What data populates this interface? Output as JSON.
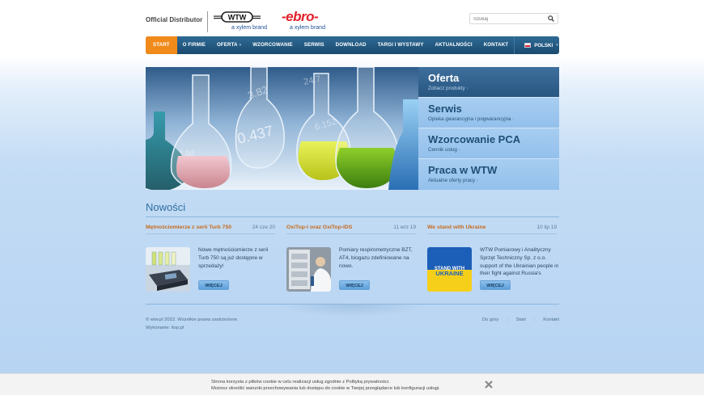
{
  "header": {
    "distributor": "Official Distributor",
    "wtw_logo": "WTW",
    "wtw_sub": "a xylem brand",
    "ebro_logo": "-ebro-",
    "ebro_sub": "a xylem brand",
    "search_placeholder": "Szukaj"
  },
  "nav": {
    "items": [
      {
        "label": "START",
        "active": true,
        "caret": false
      },
      {
        "label": "O FIRMIE",
        "caret": false
      },
      {
        "label": "OFERTA",
        "caret": true
      },
      {
        "label": "WZORCOWANIE",
        "caret": false
      },
      {
        "label": "SERWIS",
        "caret": false
      },
      {
        "label": "DOWNLOAD",
        "caret": false
      },
      {
        "label": "TARGI I WYSTAWY",
        "caret": false
      },
      {
        "label": "AKTUALNOŚCI",
        "caret": false
      },
      {
        "label": "KONTAKT",
        "caret": false
      }
    ],
    "language": "POLSKI",
    "caret_glyph": "▾"
  },
  "banner": {
    "side": [
      {
        "title": "Oferta",
        "sub": "Zobacz produkty"
      },
      {
        "title": "Serwis",
        "sub": "Opieka gwarancyjna i pogwarancyjna"
      },
      {
        "title": "Wzorcowanie PCA",
        "sub": "Cennik usług"
      },
      {
        "title": "Praca w WTW",
        "sub": "Aktualne oferty pracy"
      }
    ],
    "chevron": "›"
  },
  "news": {
    "heading": "Nowości",
    "button_label": "WIĘCEJ",
    "items": [
      {
        "title": "Mętnościomierze z serii Turb 750",
        "date": "24 cze 20",
        "text": "Nowe mętnościomierze z serii Turb 750 są już dostępne w sprzedaży!"
      },
      {
        "title": "OxiTop-i oraz OxiTop-IDS",
        "date": "11 wrz 19",
        "text": "Pomiary respirometryczne BZT, AT4, biogazu zdefiniowane na nowo."
      },
      {
        "title": "We stand with Ukraine",
        "date": "10 lip 19",
        "text": "WTW Pomiarowy i Analityczny Sprzęt Techniczny Sp. z o.o. support of the Ukrainian people in their fight against Russia's",
        "image_text_1": "STAND WITH",
        "image_text_2": "UKRAINE"
      }
    ]
  },
  "footer": {
    "copyright": "© wtw.pl 2022. Wszelkie prawa zastrzeżone.",
    "made_by": "Wykonanie: ilop.pl",
    "links": [
      "Do góry",
      "Start",
      "Kontakt"
    ],
    "separator": "|"
  },
  "cookie": {
    "line1": "Strona korzysta z plików cookie w celu realizacji usług zgodnie z Polityką prywatności.",
    "line2": "Możesz określić warunki przechowywania lub dostępu do cookie w Twojej przeglądarce lub konfiguracji usługi."
  },
  "hero_image": {
    "numbers": [
      "3.82",
      "0.437",
      "24.7",
      "6.152",
      "1.50"
    ]
  },
  "colors": {
    "nav_bg": "#1b4b70",
    "nav_active": "#f08a1a",
    "news_title": "#c86b1a",
    "side_selected": "#285681"
  }
}
